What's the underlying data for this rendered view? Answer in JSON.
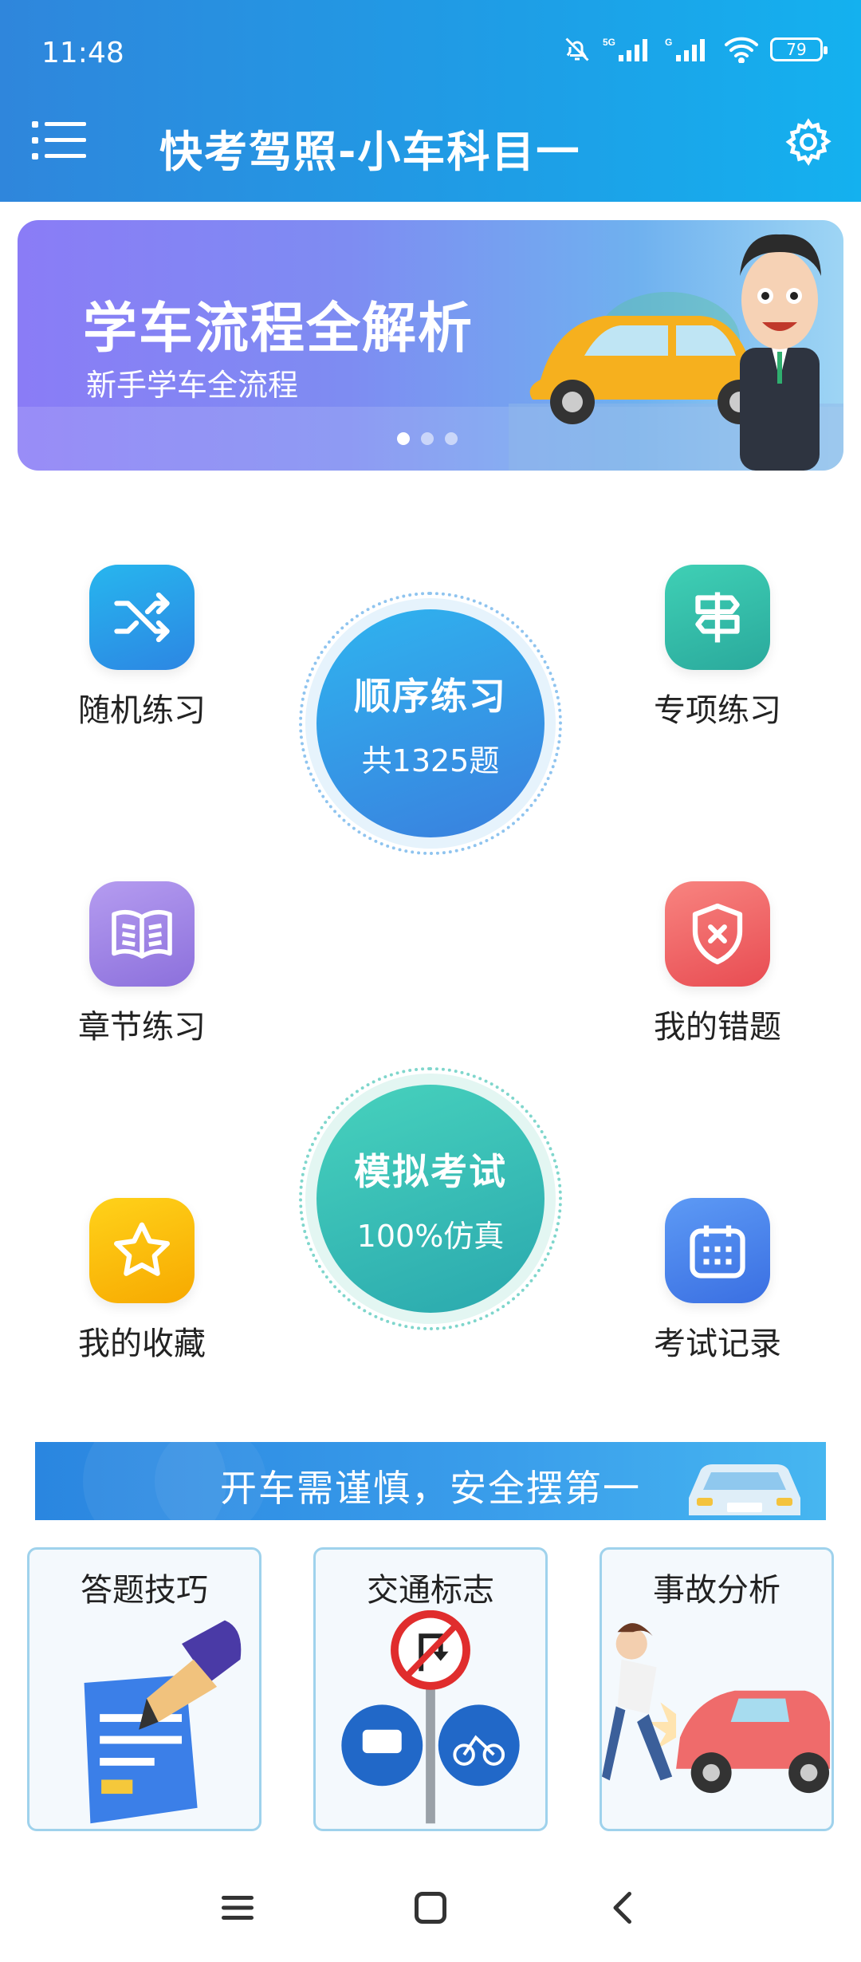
{
  "status_bar": {
    "time": "11:48",
    "battery": "79",
    "icons": [
      "bell-off-icon",
      "signal-5g-icon",
      "signal-g-icon",
      "wifi-icon",
      "battery-icon"
    ]
  },
  "header": {
    "title": "快考驾照-小车科目一",
    "menu_icon": "menu-list-icon",
    "settings_icon": "gear-icon"
  },
  "banner": {
    "title": "学车流程全解析",
    "subtitle": "新手学车全流程",
    "slide_count": 3,
    "active_slide": 1
  },
  "grid": {
    "random": {
      "label": "随机练习",
      "icon": "shuffle-icon",
      "color": "#2a8fe6"
    },
    "special": {
      "label": "专项练习",
      "icon": "signpost-icon",
      "color": "#2fbfa6"
    },
    "chapter": {
      "label": "章节练习",
      "icon": "book-icon",
      "color": "#9a7fe0"
    },
    "mistakes": {
      "label": "我的错题",
      "icon": "shield-x-icon",
      "color": "#ee5b5b"
    },
    "favorites": {
      "label": "我的收藏",
      "icon": "star-icon",
      "color": "#f7b500"
    },
    "records": {
      "label": "考试记录",
      "icon": "calendar-icon",
      "color": "#4b7fea"
    }
  },
  "sequential": {
    "title": "顺序练习",
    "count": "共1325题"
  },
  "mock_exam": {
    "title": "模拟考试",
    "subtitle": "100%仿真"
  },
  "safety_banner": {
    "text": "开车需谨慎，安全摆第一"
  },
  "cards": [
    {
      "title": "答题技巧"
    },
    {
      "title": "交通标志"
    },
    {
      "title": "事故分析"
    }
  ],
  "nav": {
    "menu_icon": "nav-menu-icon",
    "home_icon": "nav-home-icon",
    "back_icon": "nav-back-icon"
  }
}
